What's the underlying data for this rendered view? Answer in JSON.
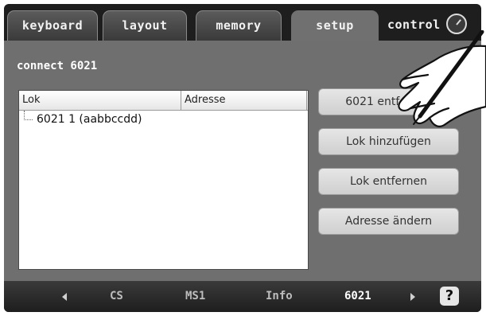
{
  "tabs": [
    {
      "label": "keyboard",
      "active": false
    },
    {
      "label": "layout",
      "active": false
    },
    {
      "label": "memory",
      "active": false
    },
    {
      "label": "setup",
      "active": true
    },
    {
      "label": "control",
      "active": false
    }
  ],
  "header_icon": "clock-icon",
  "section_title": "connect 6021",
  "list": {
    "columns": [
      "Lok",
      "Adresse"
    ],
    "rows": [
      {
        "lok": "6021 1 (aabbccdd)",
        "adresse": ""
      }
    ]
  },
  "buttons": {
    "remove_6021": "6021 entfernen",
    "add_lok": "Lok hinzufügen",
    "remove_lok": "Lok entfernen",
    "change_address": "Adresse ändern"
  },
  "bottom_bar": {
    "items": [
      "CS",
      "MS1",
      "Info",
      "6021"
    ],
    "active": "6021",
    "help": "?"
  },
  "colors": {
    "panel": "#6f6f6f",
    "frame": "#1e1e1e",
    "button": "#dcdcdc"
  }
}
